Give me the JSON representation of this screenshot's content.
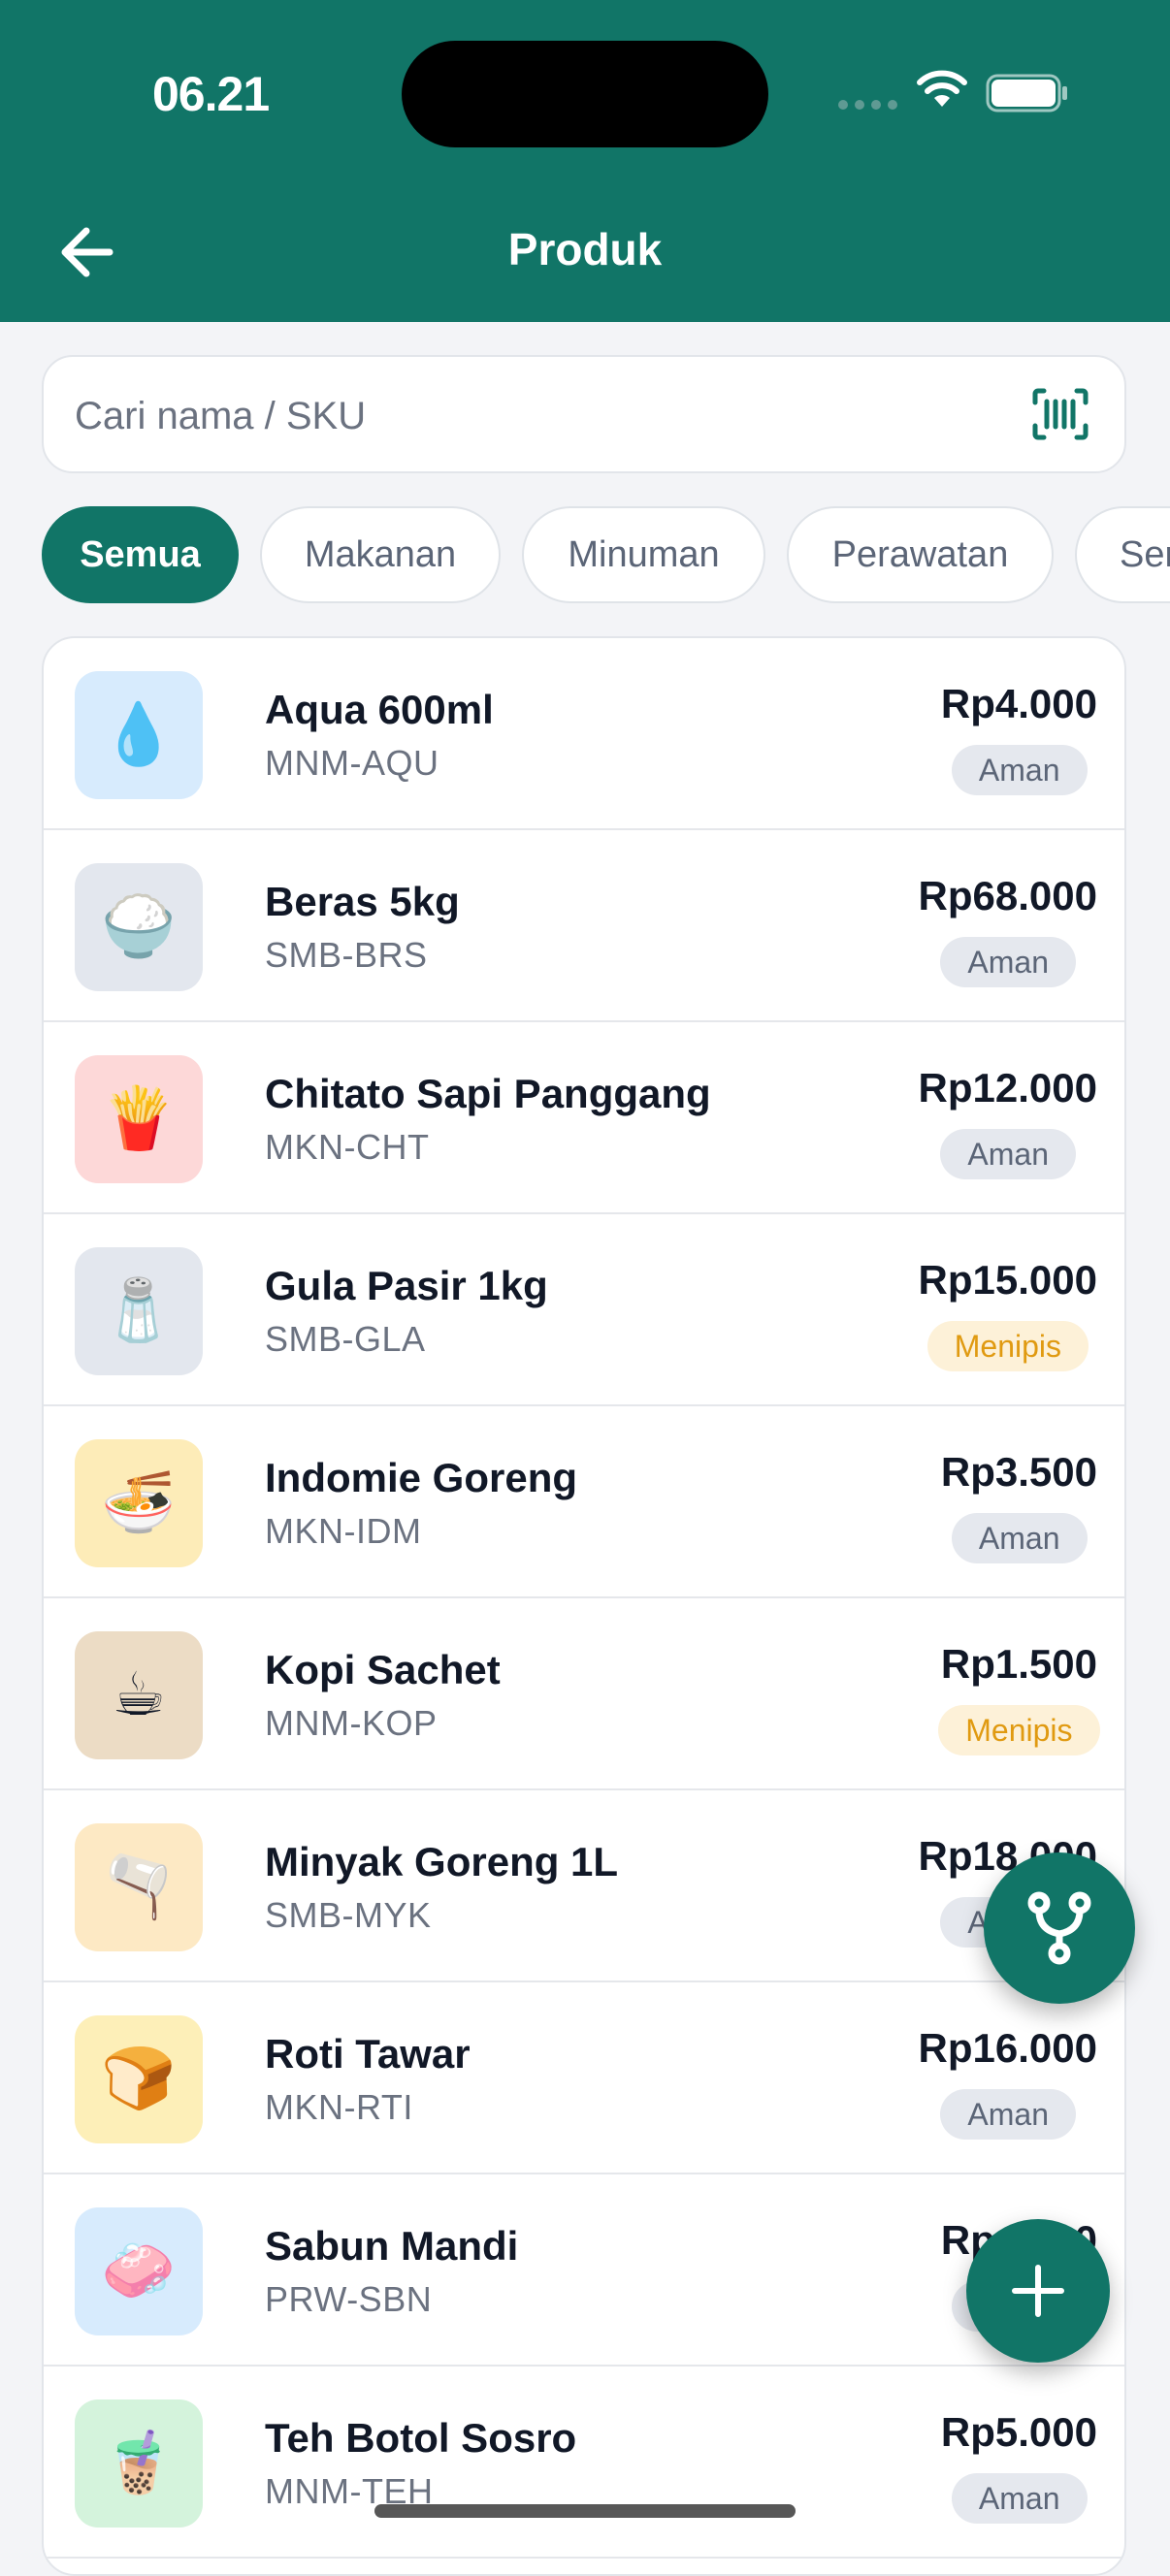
{
  "status_bar": {
    "time": "06.21"
  },
  "header": {
    "title": "Produk"
  },
  "search": {
    "placeholder": "Cari nama / SKU"
  },
  "chips": [
    {
      "label": "Semua",
      "active": true
    },
    {
      "label": "Makanan",
      "active": false
    },
    {
      "label": "Minuman",
      "active": false
    },
    {
      "label": "Perawatan",
      "active": false
    },
    {
      "label": "Ser",
      "active": false
    }
  ],
  "products": [
    {
      "name": "Aqua 600ml",
      "sku": "MNM-AQU",
      "price": "Rp4.000",
      "status": "Aman",
      "emoji": "💧",
      "thumb_bg": "#d7ebfd"
    },
    {
      "name": "Beras 5kg",
      "sku": "SMB-BRS",
      "price": "Rp68.000",
      "status": "Aman",
      "emoji": "🍚",
      "thumb_bg": "#e3e7ee"
    },
    {
      "name": "Chitato Sapi Panggang",
      "sku": "MKN-CHT",
      "price": "Rp12.000",
      "status": "Aman",
      "emoji": "🍟",
      "thumb_bg": "#fdd8d8"
    },
    {
      "name": "Gula Pasir 1kg",
      "sku": "SMB-GLA",
      "price": "Rp15.000",
      "status": "Menipis",
      "emoji": "🧂",
      "thumb_bg": "#e3e7ee"
    },
    {
      "name": "Indomie Goreng",
      "sku": "MKN-IDM",
      "price": "Rp3.500",
      "status": "Aman",
      "emoji": "🍜",
      "thumb_bg": "#fdecb8"
    },
    {
      "name": "Kopi Sachet",
      "sku": "MNM-KOP",
      "price": "Rp1.500",
      "status": "Menipis",
      "emoji": "☕",
      "thumb_bg": "#ecdcc5"
    },
    {
      "name": "Minyak Goreng 1L",
      "sku": "SMB-MYK",
      "price": "Rp18.000",
      "status": "Aman",
      "emoji": "🫗",
      "thumb_bg": "#fde9c4"
    },
    {
      "name": "Roti Tawar",
      "sku": "MKN-RTI",
      "price": "Rp16.000",
      "status": "Aman",
      "emoji": "🍞",
      "thumb_bg": "#fdefb8"
    },
    {
      "name": "Sabun Mandi",
      "sku": "PRW-SBN",
      "price": "Rp4.500",
      "status": "Aman",
      "emoji": "🧼",
      "thumb_bg": "#d7ebfd"
    },
    {
      "name": "Teh Botol Sosro",
      "sku": "MNM-TEH",
      "price": "Rp5.000",
      "status": "Aman",
      "emoji": "🧋",
      "thumb_bg": "#d4f3dc"
    }
  ],
  "colors": {
    "primary": "#117567",
    "aman_bg": "#e5e8ee",
    "menipis_bg": "#fdf1d8",
    "menipis_text": "#e09a11"
  },
  "icons": {
    "back": "arrow-left-icon",
    "barcode": "barcode-icon",
    "branch": "git-branch-icon",
    "add": "plus-icon"
  }
}
